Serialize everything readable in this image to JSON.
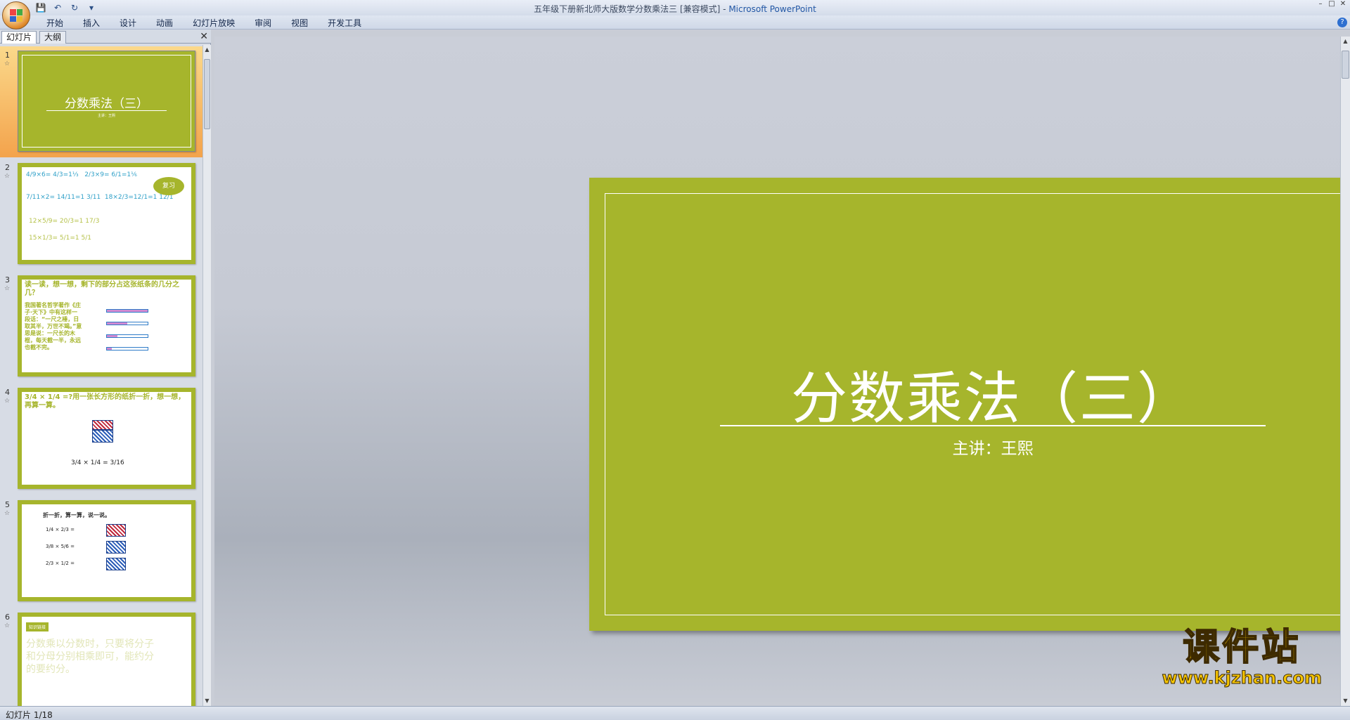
{
  "window": {
    "title": "五年级下册新北师大版数学分数乘法三 [兼容模式] - ",
    "app": "Microsoft PowerPoint"
  },
  "ribbon": {
    "tabs": [
      "开始",
      "插入",
      "设计",
      "动画",
      "幻灯片放映",
      "审阅",
      "视图",
      "开发工具"
    ]
  },
  "pane": {
    "tabs": [
      "幻灯片",
      "大纲"
    ]
  },
  "thumbs": {
    "nums": [
      "1",
      "2",
      "3",
      "4",
      "5",
      "6"
    ],
    "t1": {
      "title": "分数乘法（三）",
      "sub": "主讲：王熙"
    },
    "t2": {
      "bubble": "复习"
    },
    "t3": {
      "heading": "读一读，想一想，剩下的部分占这张纸条的几分之几？",
      "body": "我国著名哲学著作《庄子·天下》中有这样一段话：“一尺之棰，日取其半，万世不竭。”意思是说：一尺长的木棍，每天截一半，永远也截不完。"
    },
    "t4": {
      "heading": "3/4 × 1/4 =?用一张长方形的纸折一折，想一想，再算一算。",
      "formula": "3/4 × 1/4 = 3/16"
    },
    "t5": {
      "heading": "折一折，算一算，说一说。"
    },
    "t6": {
      "badge": "知识链接",
      "body": "分数乘以分数时，只要将分子和分母分别相乘即可，能约分的要约分。"
    }
  },
  "slide": {
    "title": "分数乘法（三）",
    "subtitle": "主讲：王熙"
  },
  "status": {
    "text": "幻灯片 1/18"
  },
  "watermark": {
    "brand": "课件站",
    "url": "www.kjzhan.com"
  },
  "colors": {
    "slide_green": "#a6b52c",
    "selection": "#f3a34c",
    "accent_blue": "#2fa0c8"
  },
  "icons": [
    "office-button-icon",
    "save-icon",
    "undo-icon",
    "redo-icon",
    "customize-icon",
    "help-icon",
    "close-icon",
    "minimize-icon",
    "maximize-icon",
    "scroll-up-icon",
    "scroll-down-icon",
    "star-icon"
  ]
}
